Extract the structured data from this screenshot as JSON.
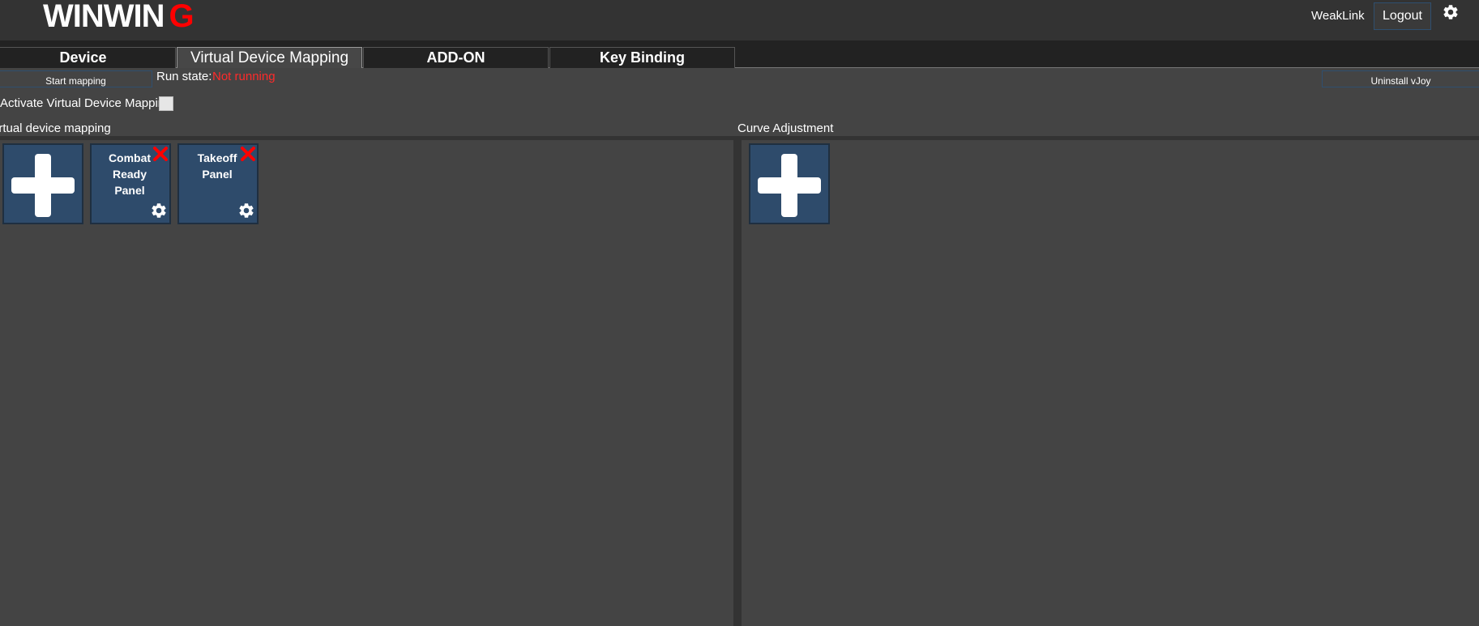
{
  "header": {
    "logo_main": "WINWIN",
    "logo_accent": "G",
    "username": "WeakLink",
    "logout_label": "Logout",
    "settings_icon": "gear-icon"
  },
  "tabs": [
    {
      "label": "Device",
      "active": false
    },
    {
      "label": "Virtual Device Mapping",
      "active": true
    },
    {
      "label": "ADD-ON",
      "active": false
    },
    {
      "label": "Key Binding",
      "active": false
    }
  ],
  "toolbar": {
    "start_label": "Start mapping",
    "run_state_label": "Run state:",
    "run_state_value": "Not running",
    "uninstall_label": "Uninstall vJoy"
  },
  "activate": {
    "label": "Activate Virtual Device Mapping",
    "checked": false
  },
  "virtual_mapping": {
    "title": "irtual device mapping",
    "add_icon": "plus-icon",
    "tiles": [
      {
        "lines": [
          "Combat",
          "Ready",
          "Panel"
        ]
      },
      {
        "lines": [
          "Takeoff",
          "Panel"
        ]
      }
    ]
  },
  "curve": {
    "title": "Curve Adjustment",
    "add_icon": "plus-icon"
  },
  "colors": {
    "background": "#444444",
    "header": "#333333",
    "tile": "#2e4b6b",
    "accent_red": "#ff0000"
  }
}
